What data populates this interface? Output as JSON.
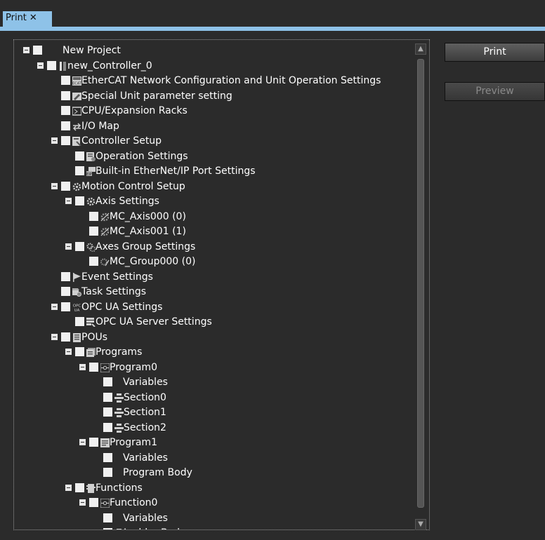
{
  "tab": {
    "label": "Print",
    "close": "✕"
  },
  "buttons": {
    "print": "Print",
    "preview": "Preview"
  },
  "colors": {
    "accent": "#8ec2e8",
    "background": "#2b2b2b",
    "text": "#ffffff"
  },
  "tree": [
    {
      "label": "New Project",
      "icon": "none",
      "expander": true
    },
    {
      "label": "new_Controller_0",
      "icon": "controller-icon",
      "expander": true
    },
    {
      "label": "EtherCAT Network Configuration and Unit Operation Settings",
      "icon": "ecat-icon",
      "expander": false
    },
    {
      "label": "Special Unit parameter setting",
      "icon": "unit-parameter-icon",
      "expander": false
    },
    {
      "label": "CPU/Expansion Racks",
      "icon": "rack-icon",
      "expander": false
    },
    {
      "label": "I/O Map",
      "icon": "io-map-icon",
      "expander": false
    },
    {
      "label": "Controller Setup",
      "icon": "controller-setup-icon",
      "expander": true
    },
    {
      "label": "Operation Settings",
      "icon": "operation-settings-icon",
      "expander": false
    },
    {
      "label": "Built-in EtherNet/IP Port Settings",
      "icon": "ethernet-ip-icon",
      "expander": false
    },
    {
      "label": "Motion Control Setup",
      "icon": "gear-icon",
      "expander": true
    },
    {
      "label": "Axis Settings",
      "icon": "gear-icon",
      "expander": true
    },
    {
      "label": "MC_Axis000 (0)",
      "icon": "axis-icon",
      "expander": false
    },
    {
      "label": "MC_Axis001 (1)",
      "icon": "axis-icon",
      "expander": false
    },
    {
      "label": "Axes Group Settings",
      "icon": "axes-group-icon",
      "expander": true
    },
    {
      "label": "MC_Group000 (0)",
      "icon": "axis-group-item-icon",
      "expander": false
    },
    {
      "label": "Event Settings",
      "icon": "flag-icon",
      "expander": false
    },
    {
      "label": "Task Settings",
      "icon": "task-icon",
      "expander": false
    },
    {
      "label": "OPC UA Settings",
      "icon": "opc-ua-icon",
      "expander": true
    },
    {
      "label": "OPC UA Server Settings",
      "icon": "server-settings-icon",
      "expander": false
    },
    {
      "label": "POUs",
      "icon": "pous-icon",
      "expander": true
    },
    {
      "label": "Programs",
      "icon": "programs-icon",
      "expander": true
    },
    {
      "label": "Program0",
      "icon": "ladder-program-icon",
      "expander": true
    },
    {
      "label": "Variables",
      "icon": "none",
      "expander": false
    },
    {
      "label": "Section0",
      "icon": "section-icon",
      "expander": false
    },
    {
      "label": "Section1",
      "icon": "section-icon",
      "expander": false
    },
    {
      "label": "Section2",
      "icon": "section-icon",
      "expander": false
    },
    {
      "label": "Program1",
      "icon": "st-program-icon",
      "expander": true
    },
    {
      "label": "Variables",
      "icon": "none",
      "expander": false
    },
    {
      "label": "Program Body",
      "icon": "none",
      "expander": false
    },
    {
      "label": "Functions",
      "icon": "functions-icon",
      "expander": true
    },
    {
      "label": "Function0",
      "icon": "ladder-program-icon",
      "expander": true
    },
    {
      "label": "Variables",
      "icon": "none",
      "expander": false
    },
    {
      "label": "Ladder Body",
      "icon": "section-icon",
      "expander": false
    }
  ]
}
